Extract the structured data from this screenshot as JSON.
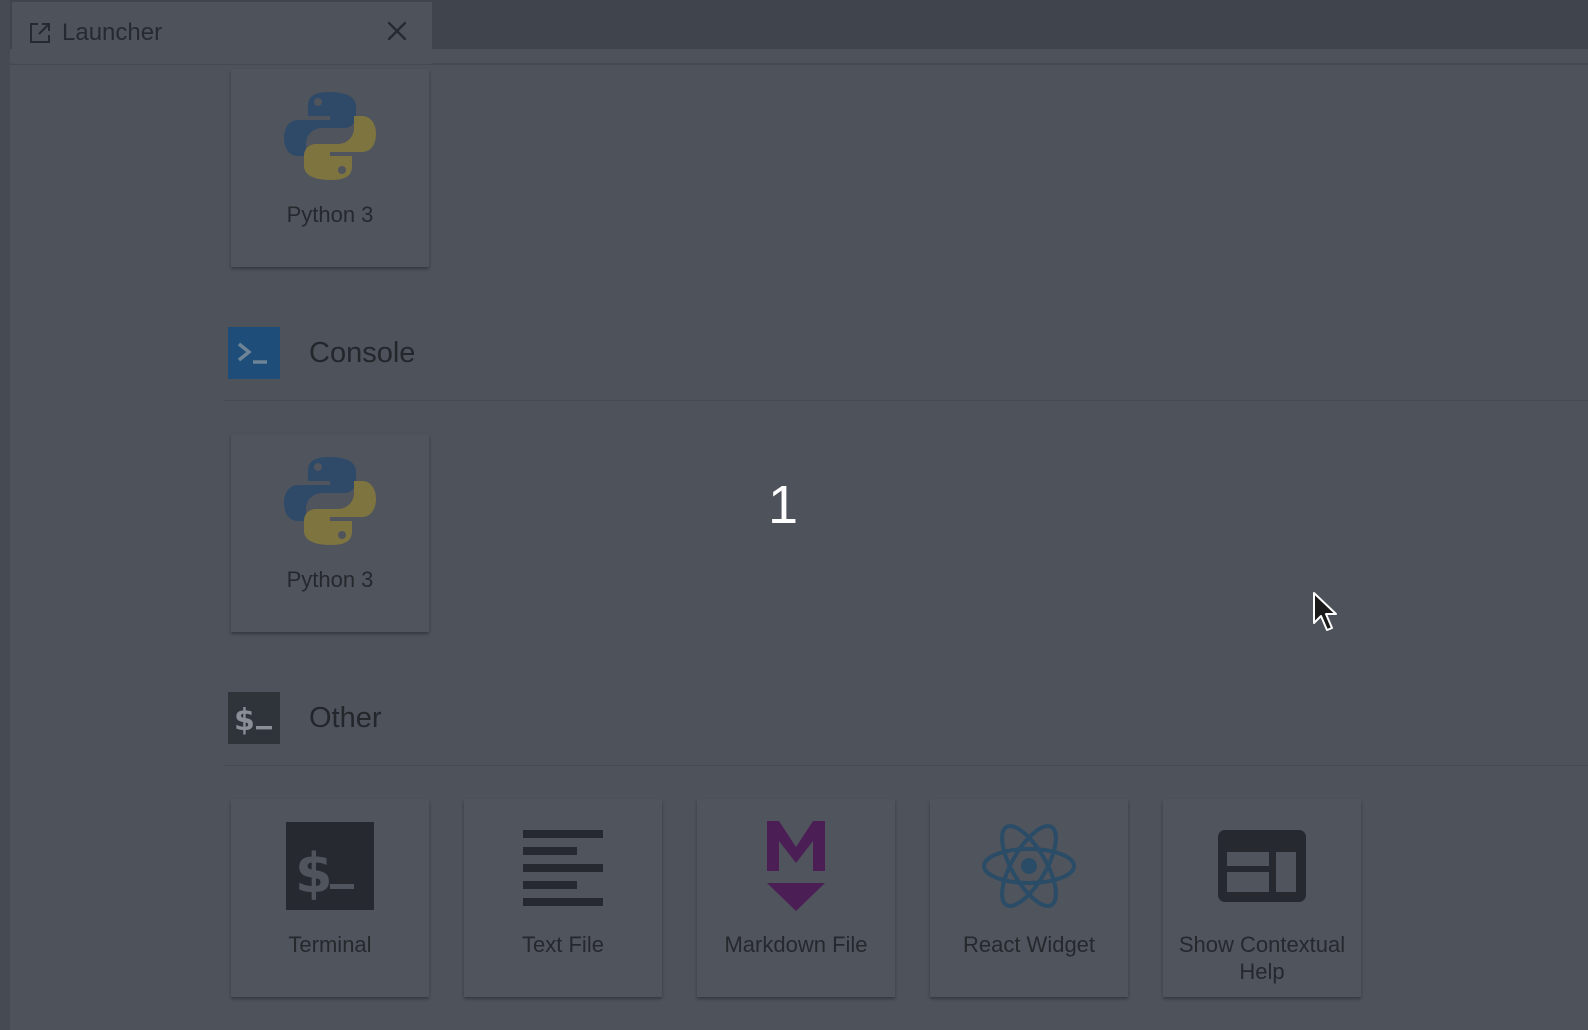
{
  "tab": {
    "label": "Launcher"
  },
  "notebook_section": {
    "cards": [
      {
        "label": "Python 3",
        "icon": "python-icon"
      }
    ]
  },
  "console_section": {
    "title": "Console",
    "icon": "console-prompt-icon",
    "cards": [
      {
        "label": "Python 3",
        "icon": "python-icon"
      }
    ]
  },
  "other_section": {
    "title": "Other",
    "icon": "terminal-dollar-icon",
    "cards": [
      {
        "label": "Terminal",
        "icon": "terminal-icon"
      },
      {
        "label": "Text File",
        "icon": "text-file-icon"
      },
      {
        "label": "Markdown File",
        "icon": "markdown-icon"
      },
      {
        "label": "React Widget",
        "icon": "react-icon"
      },
      {
        "label": "Show Contextual Help",
        "icon": "contextual-help-icon"
      }
    ]
  },
  "overlay": {
    "number": "1"
  },
  "colors": {
    "background": "#4e525b",
    "console_badge": "#1e4d7a",
    "terminal_dark": "#262a30",
    "markdown_purple": "#4b1f55",
    "react_blue": "#2a4c66",
    "python_blue": "#2e4a68",
    "python_yellow": "#7e7440"
  }
}
